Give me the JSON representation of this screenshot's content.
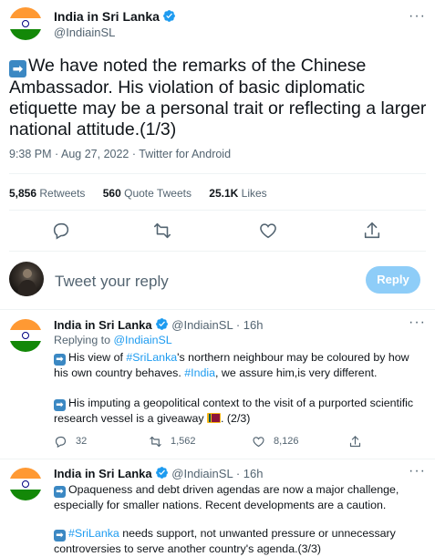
{
  "main_tweet": {
    "author_name": "India in Sri Lanka",
    "author_handle": "@IndiainSL",
    "text": "We have noted the remarks of the Chinese Ambassador. His violation of basic diplomatic etiquette may be a personal trait or reflecting a larger national attitude.(1/3)",
    "time": "9:38 PM",
    "date": "Aug 27, 2022",
    "source": "Twitter for Android",
    "stats": {
      "retweets_count": "5,856",
      "retweets_label": "Retweets",
      "quotes_count": "560",
      "quotes_label": "Quote Tweets",
      "likes_count": "25.1K",
      "likes_label": "Likes"
    }
  },
  "reply_composer": {
    "placeholder": "Tweet your reply",
    "button_label": "Reply"
  },
  "replies": [
    {
      "author_name": "India in Sri Lanka",
      "author_handle": "@IndiainSL",
      "age": "16h",
      "replying_to_label": "Replying to",
      "replying_to_handle": "@IndiainSL",
      "para1_a": "His view of ",
      "para1_tag1": "#SriLanka",
      "para1_b": "'s northern neighbour may be coloured by how his own country behaves. ",
      "para1_tag2": "#India",
      "para1_c": ", we assure him,is very different.",
      "para2": "His imputing a geopolitical context to the visit of a purported scientific research vessel is a giveaway ",
      "para2_end": ". (2/3)",
      "replies_count": "32",
      "retweets_count": "1,562",
      "likes_count": "8,126"
    },
    {
      "author_name": "India in Sri Lanka",
      "author_handle": "@IndiainSL",
      "age": "16h",
      "para1": "Opaqueness and debt driven agendas are now a major challenge, especially for smaller nations. Recent developments are a caution.",
      "para2_tag": "#SriLanka",
      "para2_rest": " needs support, not unwanted pressure or unnecessary controversies to serve another country's agenda.(3/3)"
    }
  ],
  "colors": {
    "accent": "#1d9bf0",
    "reply_button": "#8ecdf8",
    "secondary_text": "#536471"
  }
}
